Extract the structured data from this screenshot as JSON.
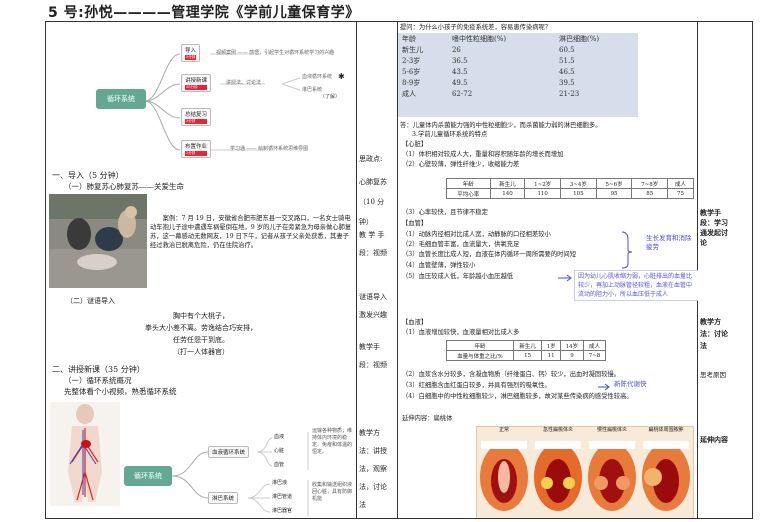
{
  "title": "5 号:孙悦————管理学院《学前儿童保育学》",
  "left": {
    "mindmap1": {
      "center": "循环系统",
      "nodes": [
        {
          "label": "导入",
          "tag": "5分钟",
          "desc": "视频案例 —— 感悟，引起学生对循环系统学习的兴趣"
        },
        {
          "label": "讲授新课",
          "tag": "35分钟",
          "desc": "讲授法、讨论法",
          "sub": [
            "血液循环系统",
            "淋巴系统"
          ],
          "note": "（了解）"
        },
        {
          "label": "总结复习",
          "tag": "3分钟",
          "desc": ""
        },
        {
          "label": "布置作业",
          "tag": "2分钟",
          "desc": "学习通 —— 绘制循环系统思维导图"
        }
      ]
    },
    "sec1": "一、导入（5 分钟）",
    "sec1_sub": "（一）肺复苏心肺复苏——关爱生命",
    "case_text": "案例：7 月 19 日，安徽省合肥市肥东县一交叉路口，一名女士骑电动车抱儿子途中遭遇车祸晕倒在地，9 岁的儿子在旁紧急为母亲做心肺复苏，这一幕感动无数网友，19 日下午，记者从孩子父亲处获悉，其妻子经过救治已脱离危险，仍在住院治疗。",
    "riddle_head": "（二）谜语导入",
    "riddle": [
      "胸中有个大桃子，",
      "拳头大小差不离。劳逸结合巧安排，",
      "任劳任怨干到底。",
      "（打一人体器官）"
    ],
    "sec2": "二、讲授新课（35 分钟）",
    "sec2_sub1": "（一）循环系统概况",
    "sec2_sub2": "先整体看个小视频，熟悉循环系统",
    "mindmap2": {
      "center": "循环系统",
      "branches": [
        {
          "label": "血液循环系统",
          "items": [
            "血液",
            "心脏",
            "血管"
          ],
          "note": "运输各种物质；维持体内环境的稳定、免疫和体温的恒定。"
        },
        {
          "label": "淋巴系统",
          "items": [
            "淋巴液",
            "淋巴管道",
            "淋巴器官"
          ],
          "note": "收集和输送组织液回心脏，具有防御机能"
        }
      ]
    }
  },
  "mid": {
    "思政点": "思政点:",
    "review": [
      "心肺复苏",
      "（10 分",
      "钟）"
    ],
    "method1": [
      "教 学 手",
      "段：视频"
    ],
    "riddle_label": [
      "谜语导入",
      "激发兴趣"
    ],
    "method2": [
      "教学手",
      "段：视频"
    ],
    "method3": [
      "教学方",
      "法：讲授",
      "法，观察",
      "法，讨论",
      "法"
    ]
  },
  "main": {
    "question": "提问：为什么小孩子的免疫系统差，容易患传染病呢？",
    "table1": {
      "headers": [
        "年龄",
        "嗜中性粒细胞(%)",
        "淋巴细胞(%)"
      ],
      "rows": [
        [
          "新生儿",
          "26",
          "60.5"
        ],
        [
          "2-3岁",
          "36.5",
          "51.5"
        ],
        [
          "5-6岁",
          "43.5",
          "46.5"
        ],
        [
          "8-9岁",
          "49.5",
          "39.5"
        ],
        [
          "成人",
          "62-72",
          "21-23"
        ]
      ]
    },
    "answer": "答：儿童体内杀菌能力强的中性粒细胞少，而杀菌能力弱的淋巴细胞多。",
    "point3": "3.学前儿童循环系统的特点",
    "heart_head": "【心脏】",
    "heart1": "（1）体积相对较成人大，重量和容积随年龄的增长而增加",
    "heart2": "（2）心壁较薄，弹性纤维少，收缩能力差",
    "table2": {
      "headers": [
        "年龄",
        "新生儿",
        "1~2岁",
        "3~4岁",
        "5~6岁",
        "7~8岁",
        "成人"
      ],
      "row": [
        "平均心率",
        "140",
        "110",
        "105",
        "95",
        "85",
        "75"
      ]
    },
    "heart3": "（3）心率较快，且节律不稳定",
    "vessel_head": "【血管】",
    "vessels": [
      "（1）动脉内径相对比成人宽，动静脉的口径相差较小",
      "（2）毛细血管丰富，血流量大，供氧充足",
      "（3）血管长度比成人短，血液在体内循环一周所需要的时间短",
      "（4）血管壁薄，弹性较小",
      "（5）血压较成人低，年龄越小血压越低"
    ],
    "note1": "生长发育和消除疲劳",
    "note2": "因为幼儿心肌收缩力弱，心脏排出的血量比较少，再加上动脉管径较粗，血液在血管中流动的阻力小，所以血压低于成人",
    "blood_head": "【血液】",
    "blood1": "（1）血液增加较快，血液量相对比成人多",
    "table3": {
      "headers": [
        "年龄",
        "新生儿",
        "1岁",
        "14岁",
        "成人"
      ],
      "row": [
        "血量与体重之比/%",
        "15",
        "11",
        "9",
        "7~8"
      ]
    },
    "blood2": "（2）血浆含水分较多，含凝血物质（纤维蛋白、钙）较少，出血时凝固较慢。",
    "blood3": "（3）红细胞含血红蛋白较多，并具有强烈的吸氧性。",
    "note3": "新陈代谢快",
    "blood4": "（4）白细胞中的中性粒细胞较少，淋巴细胞较多，故对某些传染病的感受性较高。",
    "ext": "延伸内容：扁桃体",
    "tonsil_labels": [
      "正常",
      "急性扁桃体炎",
      "慢性扁桃体炎",
      "扁桃体周围脓肿"
    ]
  },
  "right": {
    "r1": [
      "教学手",
      "段：学习",
      "通发起讨",
      "论"
    ],
    "r2": [
      "教学方",
      "法：讨论",
      "法"
    ],
    "r3": "思考原因",
    "r4": "延伸内容"
  }
}
